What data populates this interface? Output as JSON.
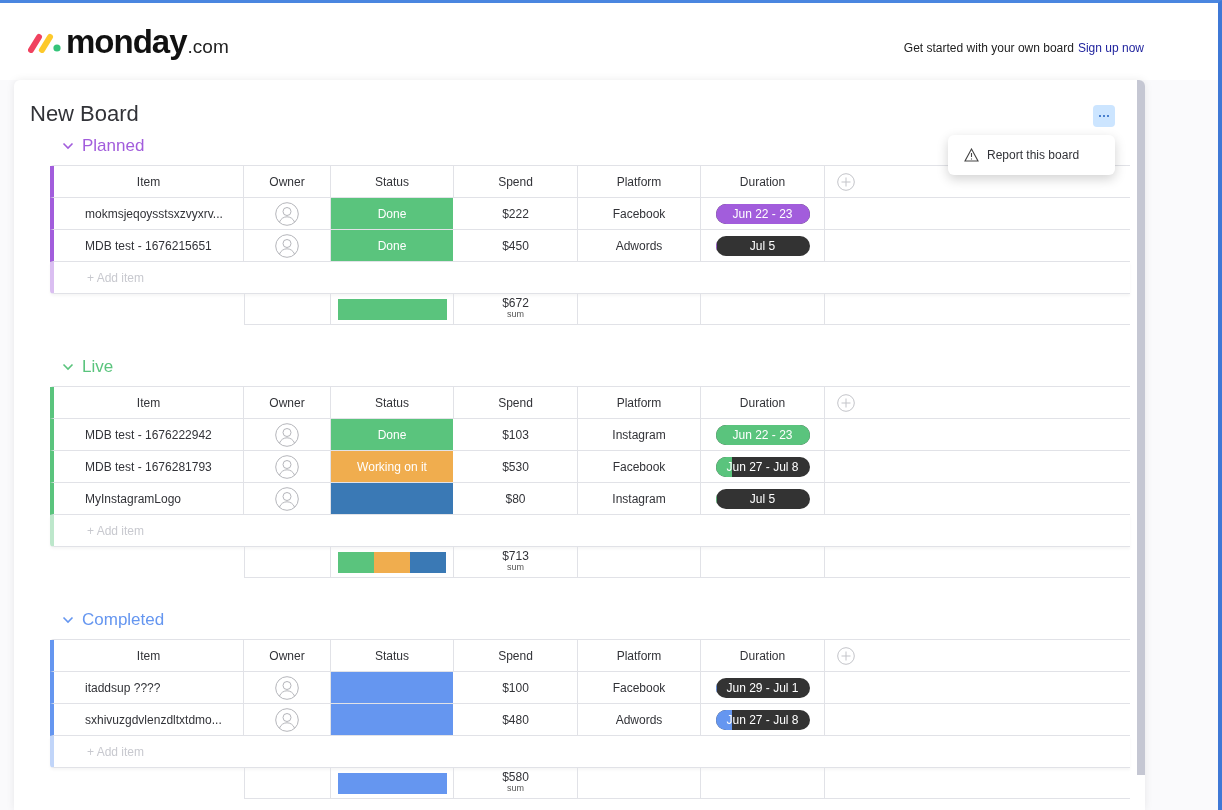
{
  "header": {
    "logo_word": "monday",
    "logo_suffix": ".com",
    "promo_text": "Get started with your own board",
    "signup_link": "Sign up now"
  },
  "board": {
    "title": "New Board"
  },
  "menu": {
    "open": true,
    "items": [
      "Report this board"
    ]
  },
  "groups": [
    {
      "name": "Planned",
      "color": "#a25ddc",
      "add_item_placeholder": "+ Add item",
      "columns": [
        "Item",
        "Owner",
        "Status",
        "Spend",
        "Platform",
        "Duration"
      ],
      "rows": [
        {
          "item": "mokmsjeqoysstsxzvyxrv...",
          "status": {
            "label": "Done",
            "color": "#5ac47d"
          },
          "spend": "$222",
          "platform": "Facebook",
          "duration": {
            "text": "Jun 22 - 23",
            "level": 1
          }
        },
        {
          "item": "MDB test - 1676215651",
          "status": {
            "label": "Done",
            "color": "#5ac47d"
          },
          "spend": "$450",
          "platform": "Adwords",
          "duration": {
            "text": "Jul 5",
            "level": 0
          }
        }
      ],
      "summary": {
        "spend": "$672",
        "spend_label": "sum"
      }
    },
    {
      "name": "Live",
      "color": "#5ac47d",
      "add_item_placeholder": "+ Add item",
      "columns": [
        "Item",
        "Owner",
        "Status",
        "Spend",
        "Platform",
        "Duration"
      ],
      "rows": [
        {
          "item": "MDB test - 1676222942",
          "status": {
            "label": "Done",
            "color": "#5ac47d"
          },
          "spend": "$103",
          "platform": "Instagram",
          "duration": {
            "text": "Jun 22 - 23",
            "level": 1
          }
        },
        {
          "item": "MDB test - 1676281793",
          "status": {
            "label": "Working on it",
            "color": "#f0ad4e"
          },
          "spend": "$530",
          "platform": "Facebook",
          "duration": {
            "text": "Jun 27 - Jul 8",
            "level": 0.18
          }
        },
        {
          "item": "MyInstagramLogo",
          "status": {
            "color": "#3a79b5"
          },
          "spend": "$80",
          "platform": "Instagram",
          "duration": {
            "text": "Jul 5",
            "level": 0
          }
        }
      ],
      "summary": {
        "spend": "$713",
        "spend_label": "sum"
      }
    },
    {
      "name": "Completed",
      "color": "#6596f0",
      "add_item_placeholder": "+ Add item",
      "columns": [
        "Item",
        "Owner",
        "Status",
        "Spend",
        "Platform",
        "Duration"
      ],
      "rows": [
        {
          "item": "itaddsup ????",
          "status": {
            "color": "#6596f0"
          },
          "spend": "$100",
          "platform": "Facebook",
          "duration": {
            "text": "Jun 29 - Jul 1",
            "level": 0
          }
        },
        {
          "item": "sxhivuzgdvlenzdltxtdmo...",
          "status": {
            "color": "#6596f0"
          },
          "spend": "$480",
          "platform": "Adwords",
          "duration": {
            "text": "Jun 27 - Jul 8",
            "level": 0.18
          }
        }
      ],
      "summary": {
        "spend": "$580",
        "spend_label": "sum"
      }
    }
  ]
}
